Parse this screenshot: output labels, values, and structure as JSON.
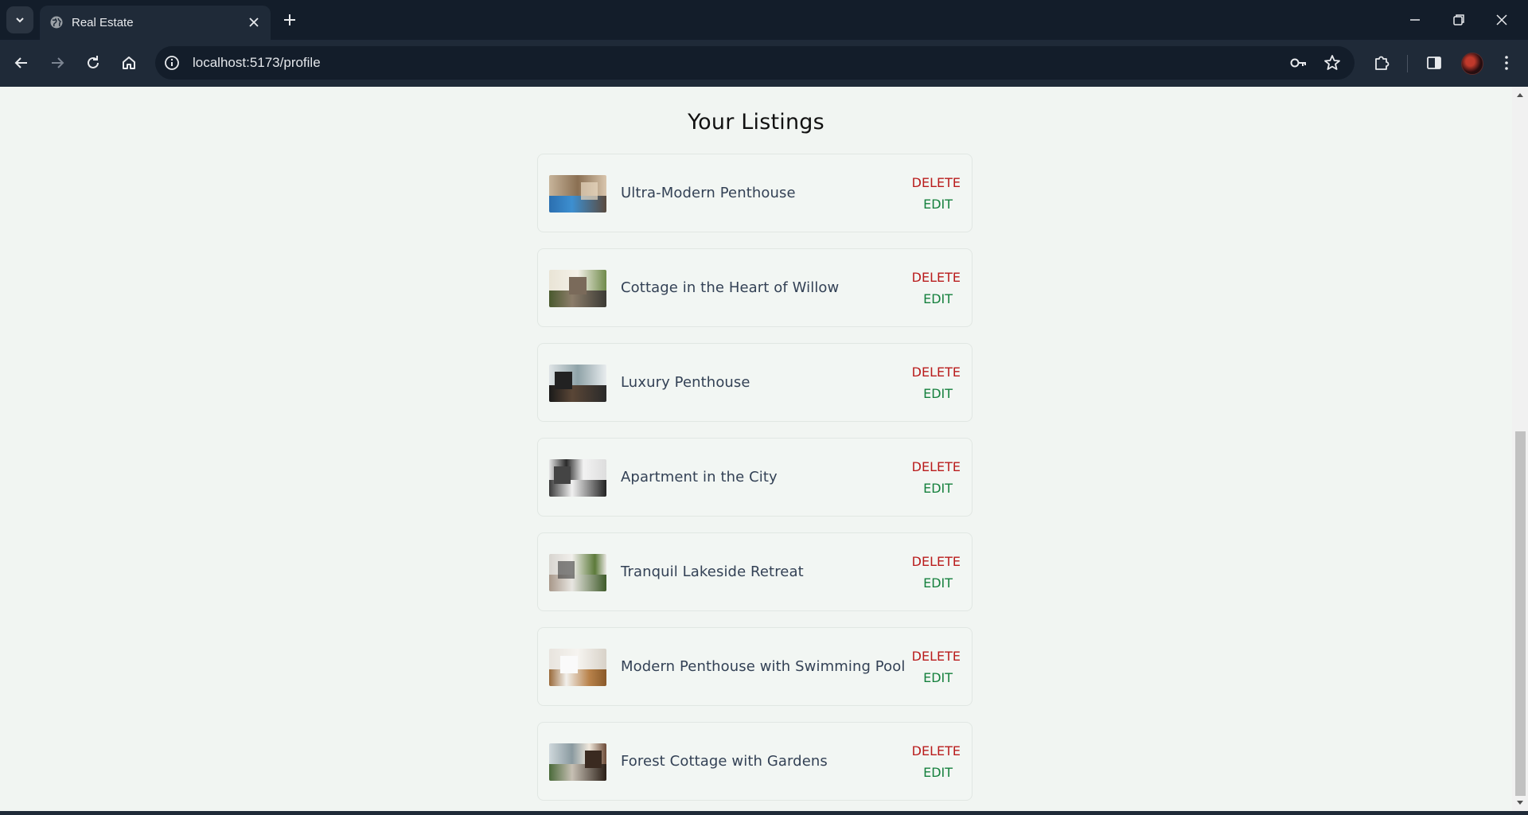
{
  "browser": {
    "tab_title": "Real Estate",
    "url": "localhost:5173/profile"
  },
  "page": {
    "heading": "Your Listings",
    "delete_label": "DELETE",
    "edit_label": "EDIT",
    "listings": [
      {
        "title": "Ultra-Modern Penthouse"
      },
      {
        "title": "Cottage in the Heart of Willow"
      },
      {
        "title": "Luxury Penthouse"
      },
      {
        "title": "Apartment in the City"
      },
      {
        "title": "Tranquil Lakeside Retreat"
      },
      {
        "title": "Modern Penthouse with Swimming Pool"
      },
      {
        "title": "Forest Cottage with Gardens"
      }
    ]
  },
  "colors": {
    "background": "#f1f5f2",
    "delete": "#b91c1c",
    "edit": "#15803d",
    "title": "#334155"
  }
}
